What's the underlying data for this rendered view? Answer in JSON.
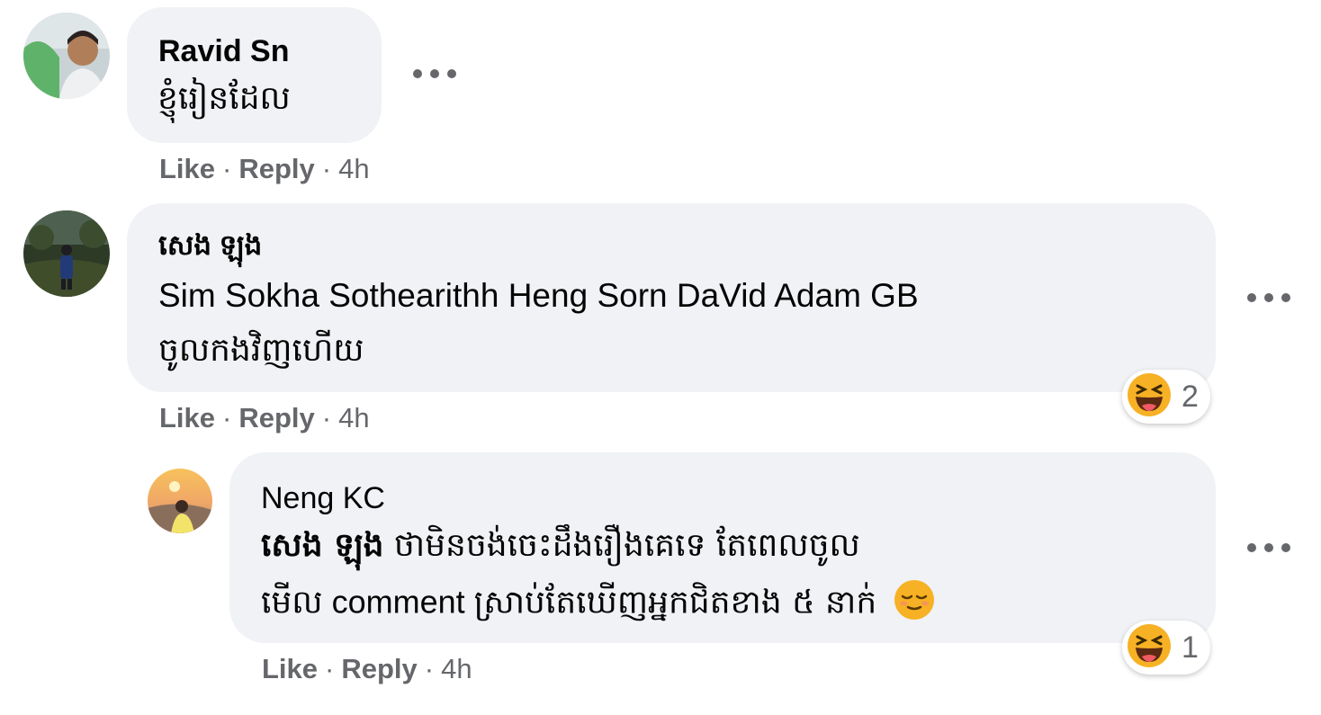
{
  "comments": [
    {
      "author": "Ravid Sn",
      "text": "ខ្ញុំរៀនដែល",
      "actions": {
        "like": "Like",
        "reply": "Reply",
        "time": "4h",
        "sep": "·"
      }
    },
    {
      "author": "សេង ឡុង",
      "line1": "Sim Sokha Sothearithh Heng Sorn DaVid Adam GB",
      "line2": "ចូលកងវិញហើយ",
      "reaction": {
        "icon": "haha-emoji-icon",
        "count": "2"
      },
      "actions": {
        "like": "Like",
        "reply": "Reply",
        "time": "4h",
        "sep": "·"
      }
    },
    {
      "author": "Neng KC",
      "mention": "សេង ឡុង",
      "line1_rest": " ថាមិនចង់ចេះដឹងរឿងគេទេ តែពេលចូល",
      "line2_a": "មើល",
      "line2_b": " comment ",
      "line2_c": "ស្រាប់តែឃើញអ្នកជិតខាង ៥ នាក់",
      "inline_emoji": "relieved-emoji-icon",
      "reaction": {
        "icon": "haha-emoji-icon",
        "count": "1"
      },
      "actions": {
        "like": "Like",
        "reply": "Reply",
        "time": "4h",
        "sep": "·"
      }
    }
  ],
  "colors": {
    "bubble": "#f0f2f5",
    "secondary_text": "#65676b",
    "primary_text": "#050505",
    "emoji_yellow": "#f7b125"
  }
}
